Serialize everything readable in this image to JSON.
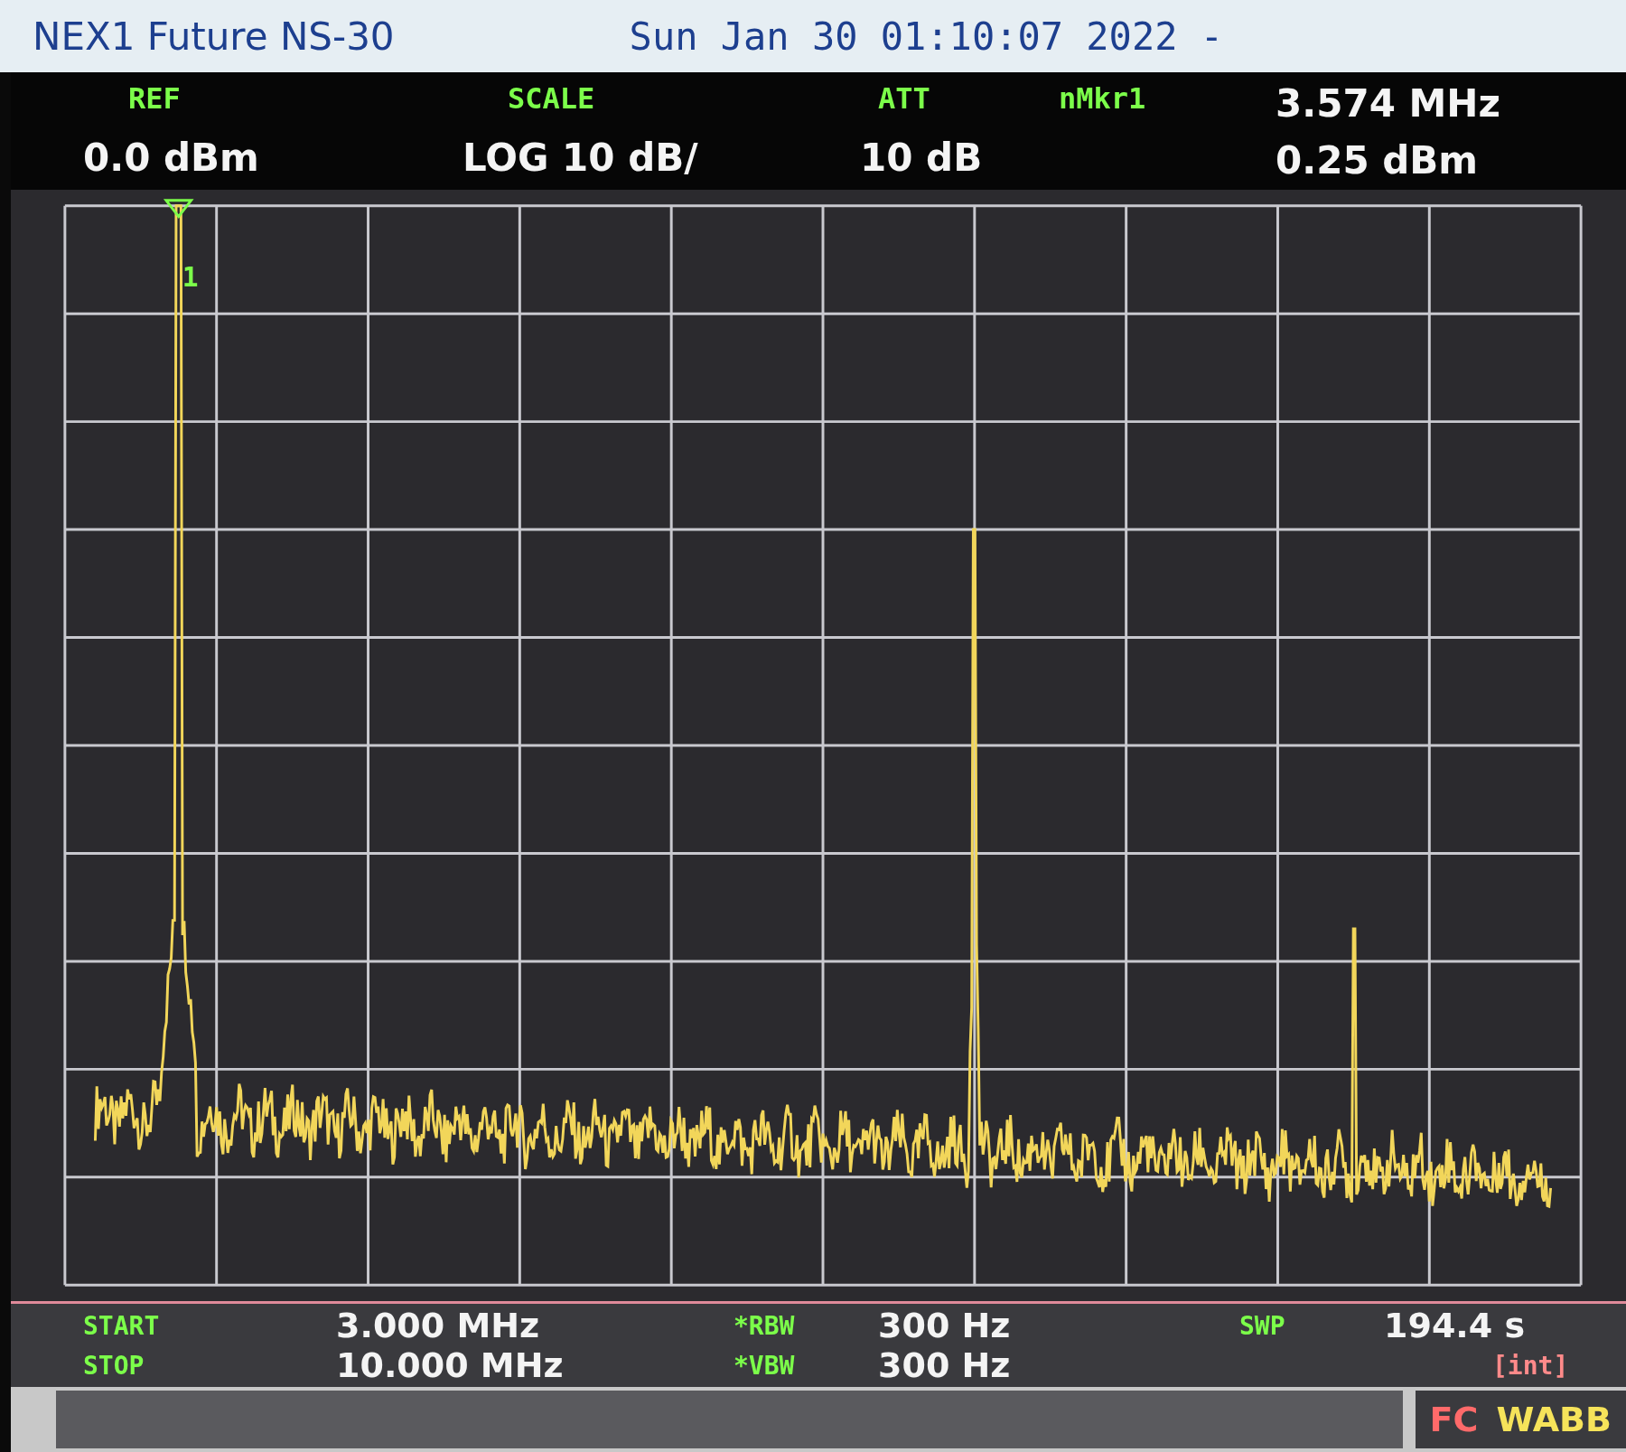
{
  "header": {
    "title": "NEX1 Future NS-30",
    "datetime": "Sun Jan 30 01:10:07 2022 -"
  },
  "settings": [
    {
      "label": "REF",
      "value": "0.0 dBm"
    },
    {
      "label": "SCALE",
      "value": "LOG 10 dB/"
    },
    {
      "label": "ATT",
      "value": "10 dB"
    }
  ],
  "marker": {
    "label": "nMkr1",
    "frequency": "3.574 MHz",
    "amplitude": "0.25 dBm",
    "number": "1"
  },
  "footer": [
    {
      "label": "START",
      "value": "3.000 MHz"
    },
    {
      "label": "STOP",
      "value": "10.000 MHz"
    },
    {
      "label": "*RBW",
      "value": "300 Hz"
    },
    {
      "label": "*VBW",
      "value": "300 Hz"
    },
    {
      "label": "SWP",
      "value": "194.4 s",
      "note": "[int]"
    }
  ],
  "status": {
    "mode": "FC",
    "coupling": "WABB"
  }
}
